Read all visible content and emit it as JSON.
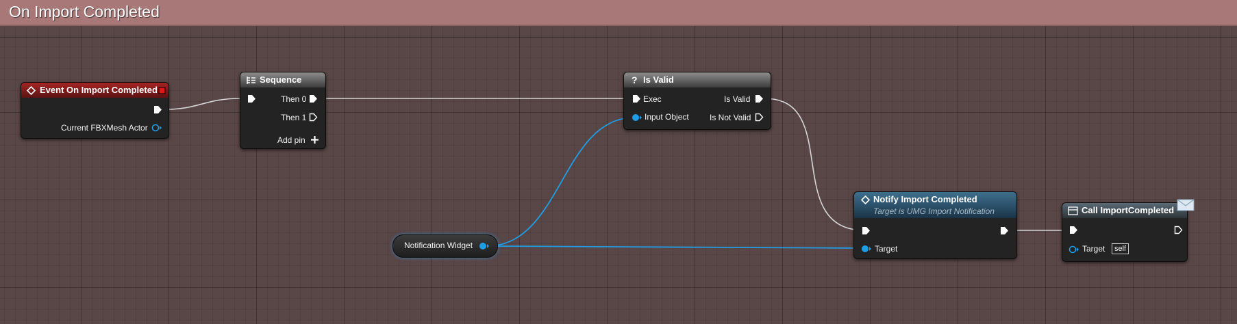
{
  "comment": {
    "title": "On Import Completed"
  },
  "colors": {
    "exec_wire": "#d8d8d8",
    "object_wire": "#1f9ee8",
    "event_header": "#a52424",
    "function_header": "#3e6f8e",
    "comment": "#a87878"
  },
  "nodes": {
    "event": {
      "title": "Event On Import Completed",
      "icon": "event-diamond-icon",
      "output_label": "Current FBXMesh Actor"
    },
    "sequence": {
      "title": "Sequence",
      "icon": "sequence-icon",
      "then0": "Then 0",
      "then1": "Then 1",
      "add_pin": "Add pin"
    },
    "is_valid": {
      "title": "Is Valid",
      "icon": "question-icon",
      "exec": "Exec",
      "input_object": "Input Object",
      "is_valid": "Is Valid",
      "is_not_valid": "Is Not Valid"
    },
    "notify": {
      "title": "Notify Import Completed",
      "subtitle": "Target is UMG Import Notification",
      "icon": "function-icon",
      "target": "Target"
    },
    "call": {
      "title": "Call ImportCompleted",
      "icon": "dispatcher-icon",
      "target": "Target",
      "target_default": "self"
    },
    "variable": {
      "label": "Notification Widget"
    }
  }
}
